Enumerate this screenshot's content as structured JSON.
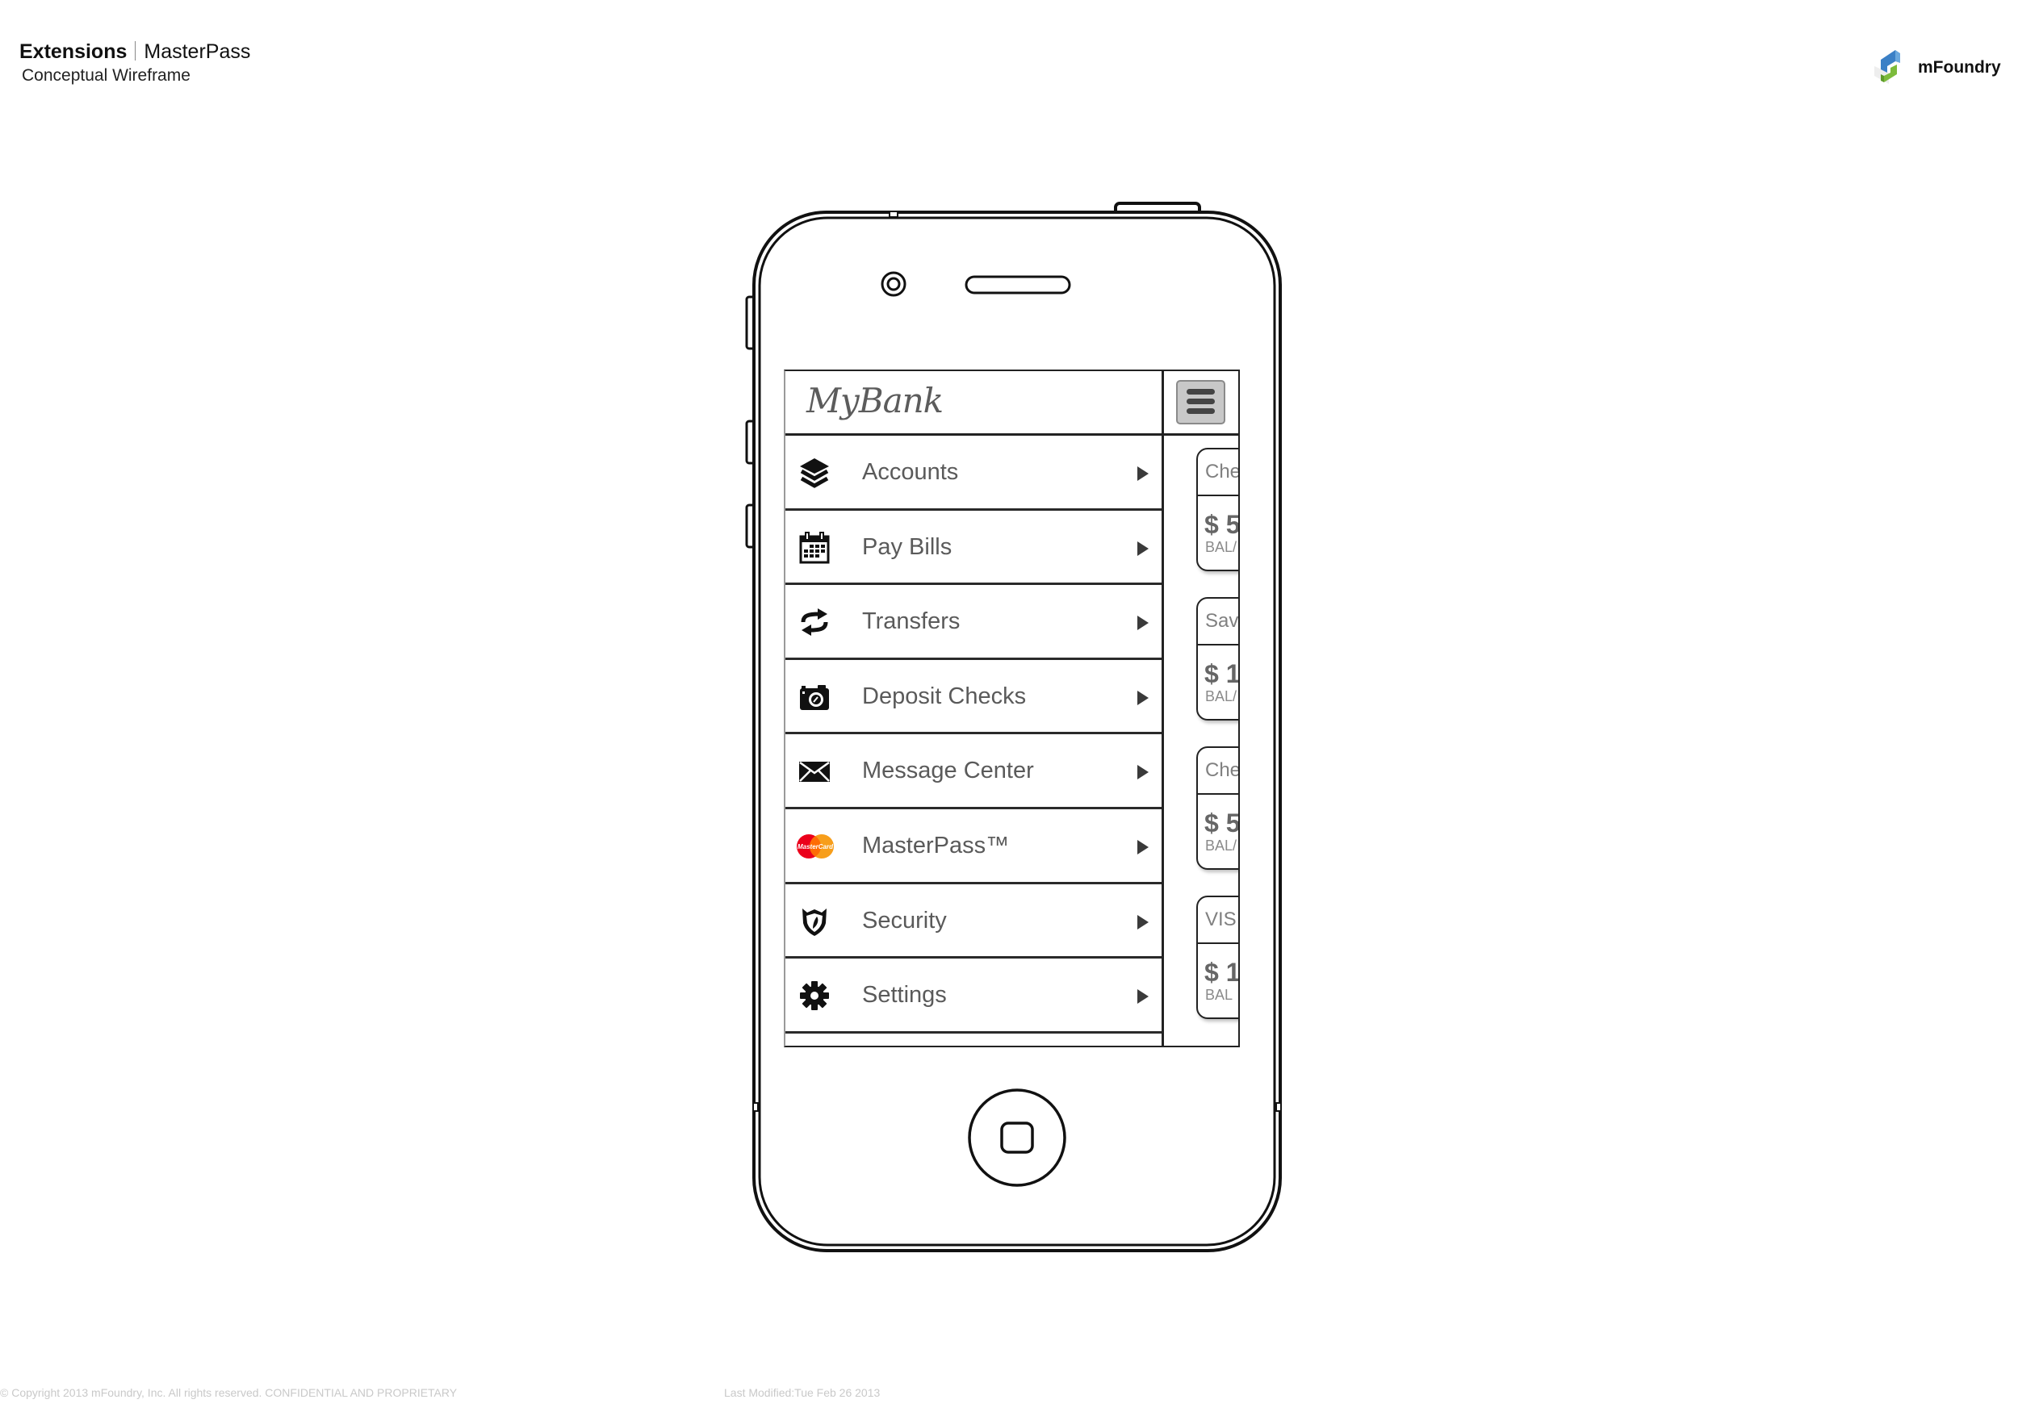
{
  "doc": {
    "title_bold": "Extensions",
    "title_rest": "MasterPass",
    "subtitle": "Conceptual Wireframe",
    "brand_name": "mFoundry",
    "footer_copyright": "© Copyright 2013 mFoundry, Inc. All rights reserved. CONFIDENTIAL AND PROPRIETARY",
    "footer_modified": "Last Modified:Tue Feb 26 2013"
  },
  "app": {
    "logo": "MyBank",
    "menu_button_icon": "hamburger-icon",
    "menu": [
      {
        "label": "Accounts",
        "icon": "layers-icon"
      },
      {
        "label": "Pay Bills",
        "icon": "calendar-icon"
      },
      {
        "label": "Transfers",
        "icon": "transfer-arrows-icon"
      },
      {
        "label": "Deposit Checks",
        "icon": "camera-icon"
      },
      {
        "label": "Message Center",
        "icon": "envelope-icon"
      },
      {
        "label": "MasterPass™",
        "icon": "mastercard-icon"
      },
      {
        "label": "Security",
        "icon": "shield-icon"
      },
      {
        "label": "Settings",
        "icon": "gear-icon"
      }
    ],
    "account_cards": [
      {
        "name": "Che",
        "amount": "$ 5",
        "balance_label": "BAL/"
      },
      {
        "name": "Sav",
        "amount": "$ 1",
        "balance_label": "BAL/"
      },
      {
        "name": "Che",
        "amount": "$ 5",
        "balance_label": "BAL/"
      },
      {
        "name": "VIS",
        "amount": "$ 1",
        "balance_label": "BAL"
      }
    ],
    "mastercard_text": "MasterCard"
  },
  "colors": {
    "mastercard_red": "#eb001b",
    "mastercard_orange": "#f79e1b",
    "brand_blue": "#3b80c6",
    "brand_green": "#7cbb3c"
  }
}
